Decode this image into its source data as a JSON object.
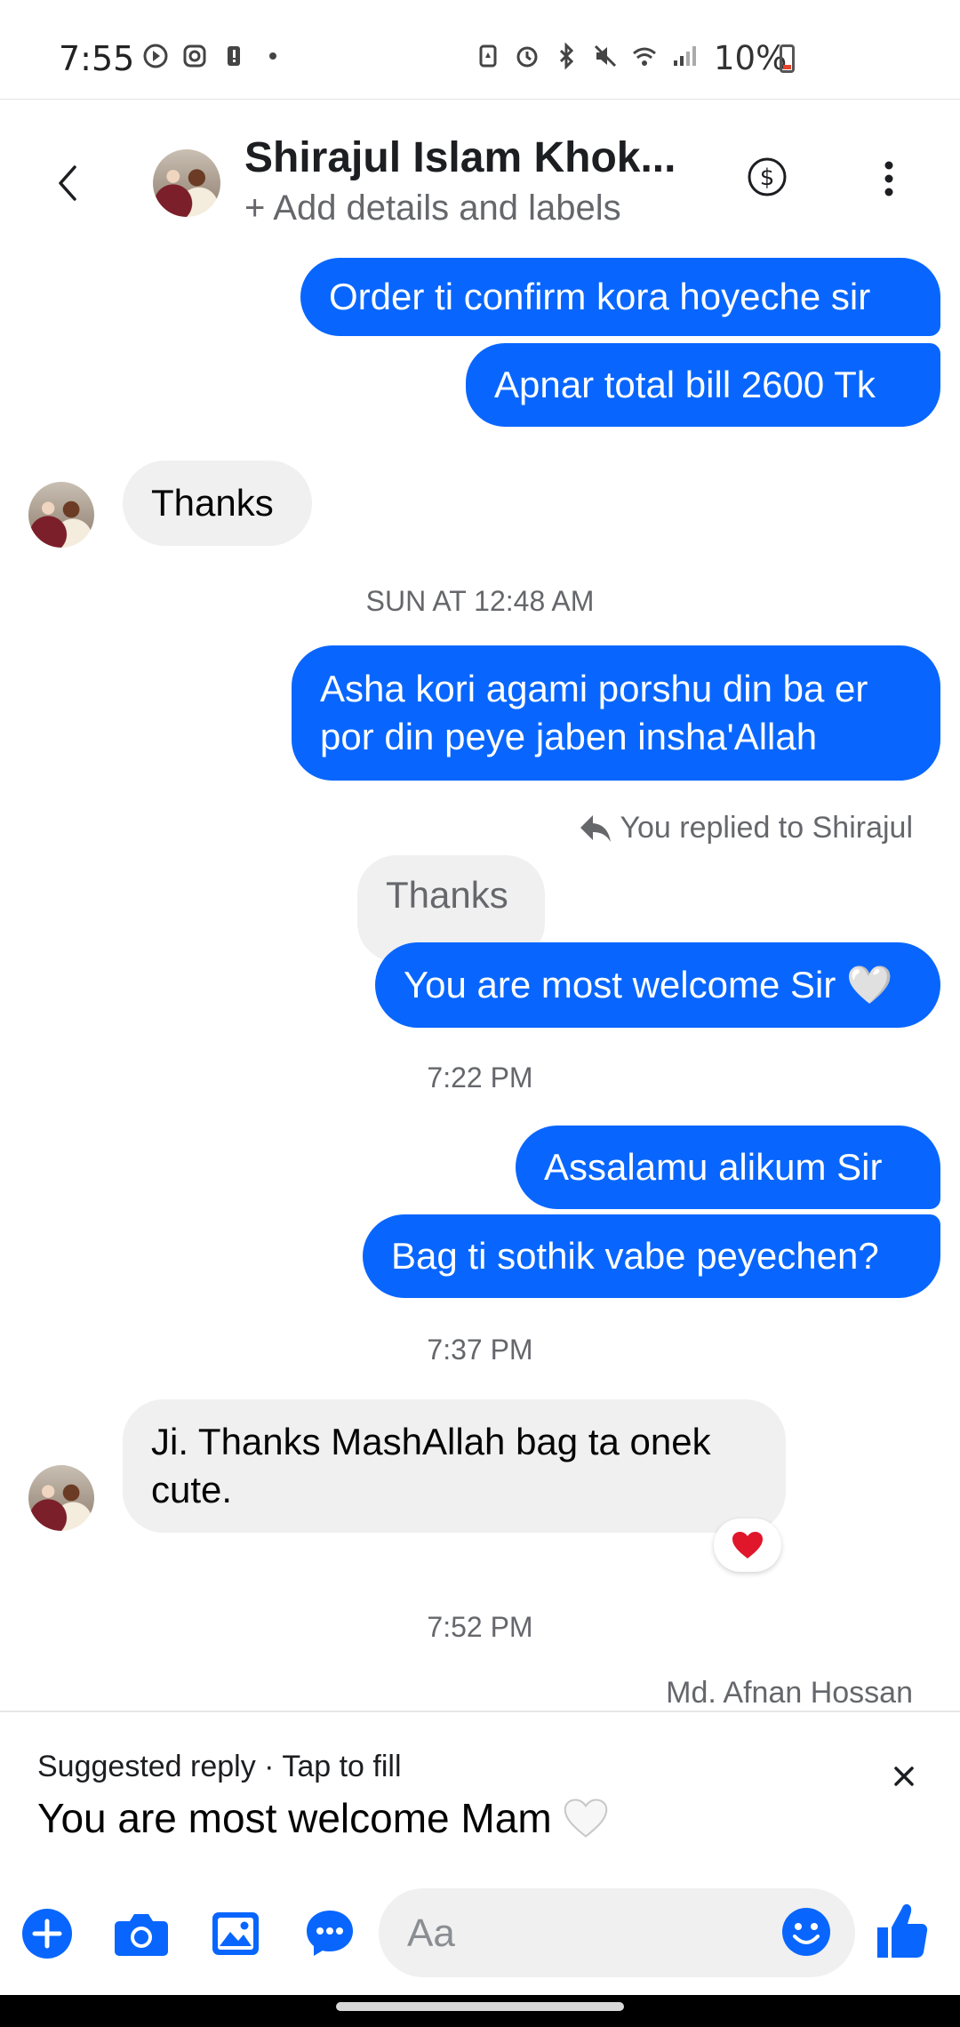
{
  "status_bar": {
    "time": "7:55",
    "battery": "10%"
  },
  "header": {
    "name": "Shirajul Islam Khok...",
    "subtitle": "+ Add details and labels"
  },
  "messages": [
    {
      "text": "Order ti confirm kora hoyeche sir"
    },
    {
      "text": "Apnar total bill 2600 Tk"
    },
    {
      "text": "Thanks"
    },
    {
      "text": "Asha kori agami porshu din ba er por din peye jaben insha'Allah"
    },
    {
      "text": "You are most welcome Sir 🤍"
    },
    {
      "text": "Assalamu alikum Sir"
    },
    {
      "text": "Bag ti sothik vabe peyechen?"
    },
    {
      "text": "Ji. Thanks MashAllah bag ta onek cute."
    }
  ],
  "timestamps": [
    "SUN AT 12:48 AM",
    "7:22 PM",
    "7:37 PM",
    "7:52 PM"
  ],
  "reply_context": {
    "label": "You replied to Shirajul",
    "quoted": "Thanks"
  },
  "reaction": "❤️",
  "seen_by": "Md. Afnan Hossan",
  "suggested_reply": {
    "title": "Suggested reply · Tap to fill",
    "text": "You are most welcome Mam",
    "emoji": "🤍"
  },
  "composer": {
    "placeholder": "Aa"
  },
  "colors": {
    "outgoing": "#0866ff",
    "incoming": "#f0f0f0",
    "accent": "#0866ff"
  }
}
